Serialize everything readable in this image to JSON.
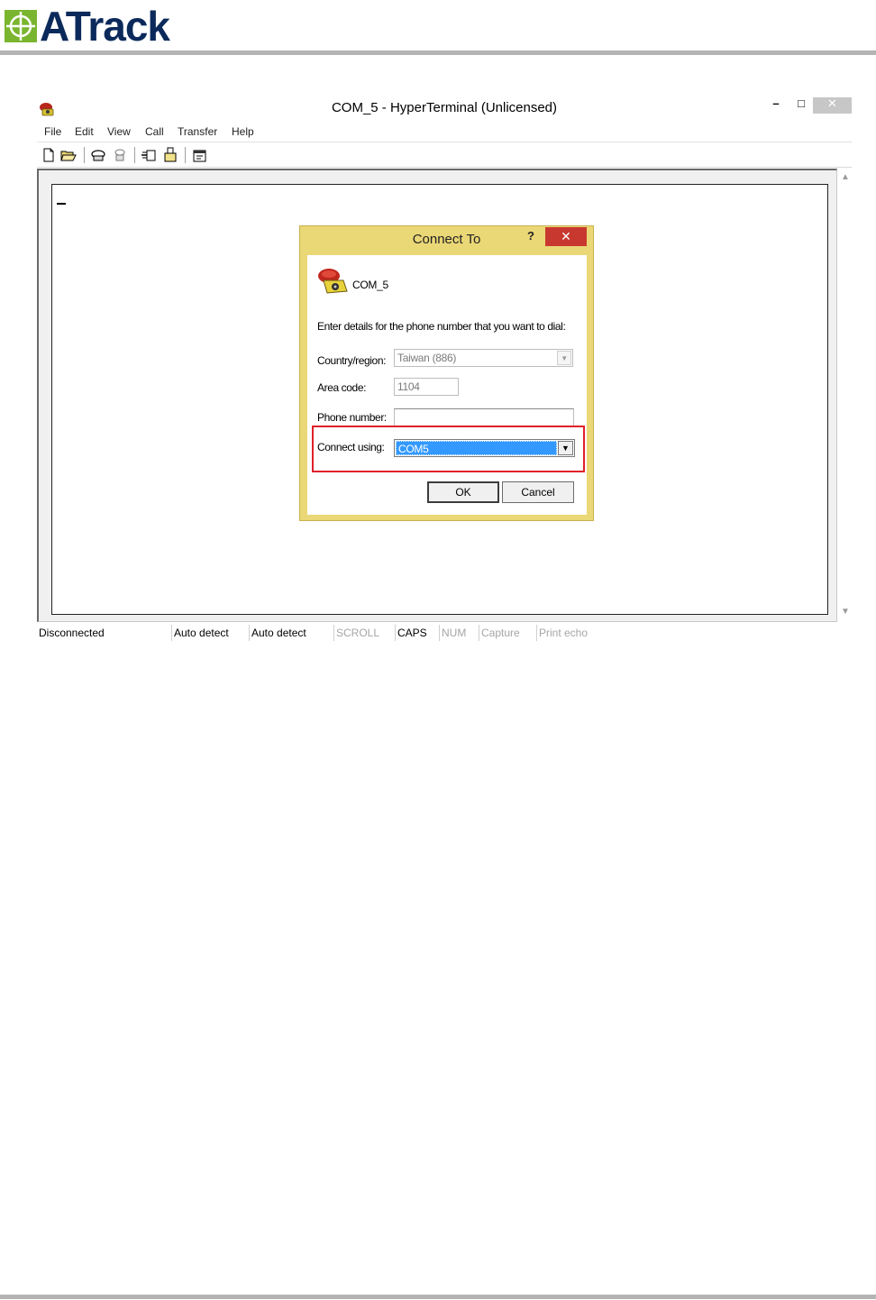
{
  "brand": {
    "name": "ATrack"
  },
  "window": {
    "title": "COM_5 - HyperTerminal (Unlicensed)",
    "controls": {
      "minimize": "–",
      "maximize": "□",
      "close": "✕"
    },
    "menu": [
      "File",
      "Edit",
      "View",
      "Call",
      "Transfer",
      "Help"
    ],
    "toolbar_icons": [
      "new-file-icon",
      "open-folder-icon",
      "call-icon",
      "disconnect-icon",
      "send-icon",
      "receive-icon",
      "properties-icon"
    ],
    "status": [
      {
        "label": "Disconnected",
        "enabled": true
      },
      {
        "label": "Auto detect",
        "enabled": true
      },
      {
        "label": "Auto detect",
        "enabled": true
      },
      {
        "label": "SCROLL",
        "enabled": false
      },
      {
        "label": "CAPS",
        "enabled": true
      },
      {
        "label": "NUM",
        "enabled": false
      },
      {
        "label": "Capture",
        "enabled": false
      },
      {
        "label": "Print echo",
        "enabled": false
      }
    ]
  },
  "dialog": {
    "title": "Connect To",
    "help": "?",
    "close": "✕",
    "connection_name": "COM_5",
    "prompt": "Enter details for the phone number that you want to dial:",
    "country_label": "Country/region:",
    "country_value": "Taiwan (886)",
    "area_label": "Area code:",
    "area_value": "1104",
    "phone_label": "Phone number:",
    "phone_value": "",
    "connect_label": "Connect using:",
    "connect_value": "COM5",
    "ok": "OK",
    "cancel": "Cancel"
  },
  "colors": {
    "brand_navy": "#0b2a5b",
    "brand_green": "#7ab530",
    "dialog_frame": "#ead776",
    "close_red": "#c8382f",
    "highlight_box": "#e0202a",
    "selection_blue": "#3399ff"
  }
}
